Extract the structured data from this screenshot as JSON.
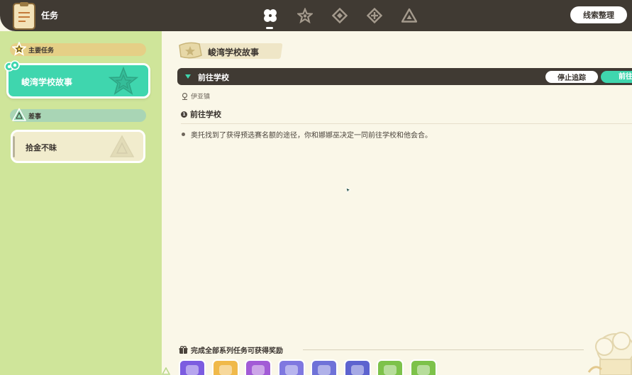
{
  "header": {
    "title": "任务",
    "tabs": [
      {
        "icon": "clover-icon",
        "active": true
      },
      {
        "icon": "star-icon",
        "active": false
      },
      {
        "icon": "diamond-icon",
        "active": false
      },
      {
        "icon": "diamond-cross-icon",
        "active": false
      },
      {
        "icon": "triangle-icon",
        "active": false
      }
    ],
    "clue_button": "线索整理"
  },
  "sidebar": {
    "main_section": "主要任务",
    "main_quest": "峻湾学校故事",
    "side_section": "差事",
    "side_quest": "拾金不昧"
  },
  "quest": {
    "title": "峻湾学校故事",
    "goal": "前往学校",
    "stop_button": "停止追踪",
    "go_button": "前往",
    "location": "伊亚镇",
    "step_number": "1",
    "step_title": "前往学校",
    "description": "奥托找到了获得预选赛名额的途径，你和娜娜巫决定一同前往学校和他会合。"
  },
  "rewards": {
    "heading": "完成全部系列任务可获得奖励",
    "items": [
      {
        "name": "reward-purple-gem",
        "color": "#7c5ce0"
      },
      {
        "name": "reward-rainbow-crystal",
        "color": "#f0b94a"
      },
      {
        "name": "reward-purple-orb",
        "color": "#a25bd6"
      },
      {
        "name": "reward-green-ticket",
        "color": "#7f78e0"
      },
      {
        "name": "reward-green-badge",
        "color": "#6f72d8"
      },
      {
        "name": "reward-gold-bar",
        "color": "#5d63cf"
      },
      {
        "name": "reward-pink-stick",
        "color": "#7dc24a"
      },
      {
        "name": "reward-green-sparkle",
        "color": "#7dc24a"
      }
    ]
  },
  "colors": {
    "topbar": "#403a33",
    "accent": "#3fd6ae",
    "sidebar": "#cfe59a",
    "background": "#faf7e8"
  }
}
